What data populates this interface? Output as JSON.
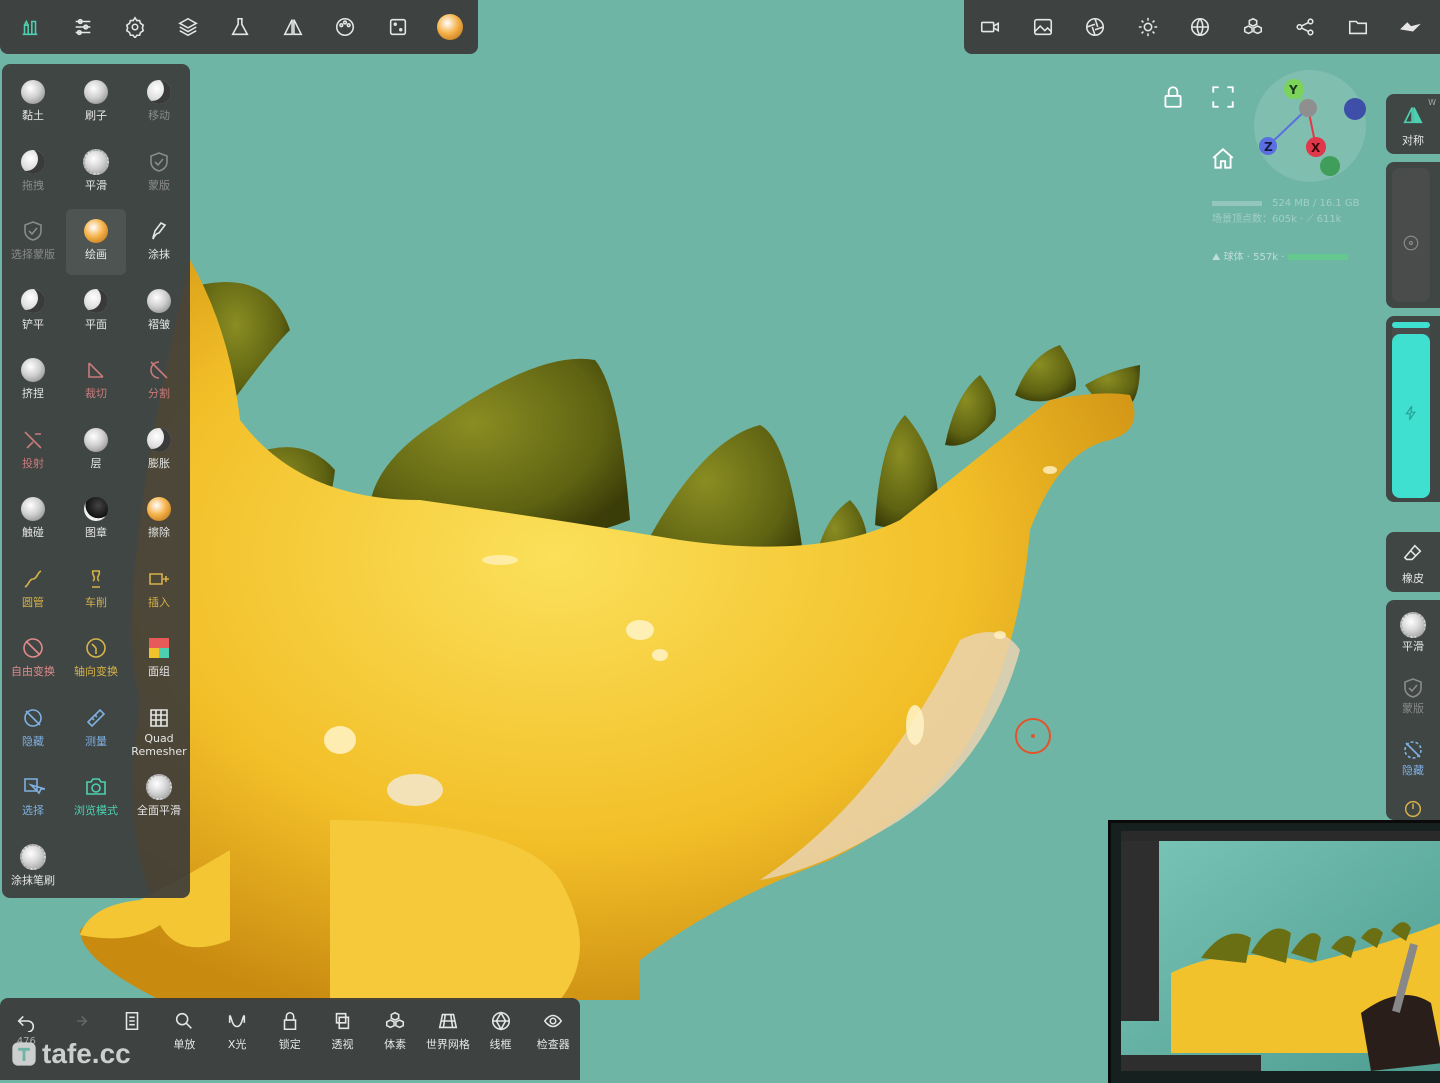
{
  "top_left_toolbar": {
    "icons": [
      "scene-icon",
      "settings-sliders-icon",
      "gear-icon",
      "layers-icon",
      "flask-icon",
      "symmetry-icon",
      "palette-icon",
      "dice-icon",
      "material-sphere-icon"
    ]
  },
  "top_right_toolbar": {
    "icons": [
      "camera-icon",
      "image-icon",
      "aperture-icon",
      "light-icon",
      "globe-icon",
      "voxel-icon",
      "share-icon",
      "folder-icon",
      "undo-arrow-icon"
    ]
  },
  "tools": [
    {
      "label": "黏土",
      "icon": "clay-brush-icon",
      "color": "#e6e6e6"
    },
    {
      "label": "刷子",
      "icon": "brush-icon",
      "color": "#e6e6e6"
    },
    {
      "label": "移动",
      "icon": "move-brush-icon",
      "color": "#8a8a8a"
    },
    {
      "label": "拖拽",
      "icon": "drag-brush-icon",
      "color": "#8a8a8a"
    },
    {
      "label": "平滑",
      "icon": "smooth-brush-icon",
      "color": "#e6e6e6"
    },
    {
      "label": "蒙版",
      "icon": "mask-icon",
      "color": "#8a8a8a"
    },
    {
      "label": "选择蒙版",
      "icon": "select-mask-icon",
      "color": "#8a8a8a"
    },
    {
      "label": "绘画",
      "icon": "paint-icon",
      "color": "#e6e6e6"
    },
    {
      "label": "涂抹",
      "icon": "smudge-icon",
      "color": "#e6e6e6"
    },
    {
      "label": "铲平",
      "icon": "flatten-icon",
      "color": "#e6e6e6"
    },
    {
      "label": "平面",
      "icon": "planar-icon",
      "color": "#e6e6e6"
    },
    {
      "label": "褶皱",
      "icon": "crease-icon",
      "color": "#e6e6e6"
    },
    {
      "label": "挤捏",
      "icon": "pinch-icon",
      "color": "#e6e6e6"
    },
    {
      "label": "裁切",
      "icon": "trim-icon",
      "color": "#c97a7a"
    },
    {
      "label": "分割",
      "icon": "split-icon",
      "color": "#c97a7a"
    },
    {
      "label": "投射",
      "icon": "project-icon",
      "color": "#c97a7a"
    },
    {
      "label": "层",
      "icon": "layer-brush-icon",
      "color": "#e6e6e6"
    },
    {
      "label": "膨胀",
      "icon": "inflate-icon",
      "color": "#e6e6e6"
    },
    {
      "label": "触碰",
      "icon": "tube-touch-icon",
      "color": "#e6e6e6"
    },
    {
      "label": "图章",
      "icon": "stamp-icon",
      "color": "#e6e6e6"
    },
    {
      "label": "擦除",
      "icon": "erase-paint-icon",
      "color": "#e6e6e6"
    },
    {
      "label": "圆管",
      "icon": "tube-icon",
      "color": "#d6b24a"
    },
    {
      "label": "车削",
      "icon": "lathe-icon",
      "color": "#d6b24a"
    },
    {
      "label": "插入",
      "icon": "insert-icon",
      "color": "#d6b24a"
    },
    {
      "label": "自由变换",
      "icon": "free-transform-icon",
      "color": "#e08a8a"
    },
    {
      "label": "轴向变换",
      "icon": "axis-transform-icon",
      "color": "#d6b24a"
    },
    {
      "label": "面组",
      "icon": "facegroup-icon",
      "color": "#e6e6e6"
    },
    {
      "label": "隐藏",
      "icon": "hide-icon",
      "color": "#7fb0e0"
    },
    {
      "label": "测量",
      "icon": "ruler-icon",
      "color": "#7fb0e0"
    },
    {
      "label": "Quad Remesher",
      "icon": "quad-remesher-icon",
      "color": "#e6e6e6"
    },
    {
      "label": "选择",
      "icon": "select-icon",
      "color": "#7fb0e0"
    },
    {
      "label": "浏览模式",
      "icon": "view-mode-icon",
      "color": "#4ed0b0"
    },
    {
      "label": "全面平滑",
      "icon": "global-smooth-icon",
      "color": "#e6e6e6"
    },
    {
      "label": "涂抹笔刷",
      "icon": "smudge-brush-icon",
      "color": "#e6e6e6"
    }
  ],
  "bottom_toolbar": [
    {
      "label": "476",
      "icon": "undo-icon"
    },
    {
      "label": "",
      "icon": "redo-icon"
    },
    {
      "label": "",
      "icon": "document-icon"
    },
    {
      "label": "单放",
      "icon": "search-icon"
    },
    {
      "label": "X光",
      "icon": "xray-icon"
    },
    {
      "label": "锁定",
      "icon": "lock-icon"
    },
    {
      "label": "透视",
      "icon": "perspective-icon"
    },
    {
      "label": "体素",
      "icon": "voxel-icon"
    },
    {
      "label": "世界网格",
      "icon": "world-grid-icon"
    },
    {
      "label": "线框",
      "icon": "wireframe-icon"
    },
    {
      "label": "检查器",
      "icon": "inspector-icon"
    }
  ],
  "watermark": "tafe.cc",
  "viewport": {
    "gizmo": {
      "y": "Y",
      "x": "X",
      "z": "Z",
      "colors": {
        "y": "#7bd35a",
        "x": "#e0384a",
        "z": "#5a6fe0",
        "blue": "#3d4fa8",
        "green": "#3f9f5a"
      }
    },
    "stats": {
      "memory": "524 MB / 16.1 GB",
      "vertices": "场景顶点数：605k · ⟋ 611k",
      "mesh": "⛰ 球体 · 557k · "
    }
  },
  "right_panel": {
    "symmetry_label": "对称",
    "symmetry_badge": "W",
    "eraser_label": "橡皮",
    "smooth_label": "平滑",
    "mask_label": "蒙版",
    "hide_label": "隐藏"
  },
  "colors": {
    "background": "#6fb5a6",
    "dino_body": "#f3c52d",
    "dino_plates": "#6b6f14",
    "accent_cyan": "#3fe0d0",
    "brush_cursor": "#e0552a"
  }
}
